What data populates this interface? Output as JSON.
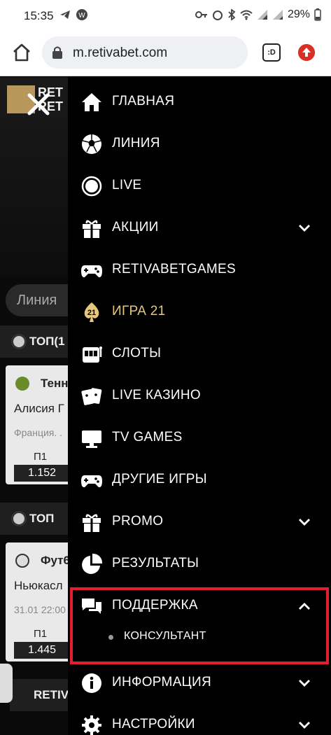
{
  "status_bar": {
    "time": "15:35",
    "battery": "29%"
  },
  "browser": {
    "url": "m.retivabet.com",
    "tabs_label": ":D"
  },
  "background_site": {
    "logo_text_1": "RET",
    "logo_text_2": "RET",
    "search_placeholder": "Линия",
    "section_top_1": "ТОП(1",
    "card_1": {
      "sport": "Тенн",
      "teams": "Алисия Г",
      "league": "Франция. .",
      "odd_label": "П1",
      "odd_value": "1.152"
    },
    "section_top_2": "ТОП",
    "card_2": {
      "sport": "Фут6",
      "teams": "Ньюкасл",
      "league": "31.01 22:00",
      "odd_label": "П1",
      "odd_value": "1.445"
    },
    "section_retiv": "RETIV"
  },
  "menu": {
    "items": [
      {
        "label": "ГЛАВНАЯ",
        "icon": "home-icon"
      },
      {
        "label": "ЛИНИЯ",
        "icon": "soccer-ball-icon"
      },
      {
        "label": "LIVE",
        "icon": "live-circle-icon"
      },
      {
        "label": "АКЦИИ",
        "icon": "gift-icon",
        "expandable": true
      },
      {
        "label": "RETIVABETGAMES",
        "icon": "gamepad-icon"
      },
      {
        "label": "ИГРА 21",
        "icon": "blackjack-21-icon",
        "accent": "#e8c67a"
      },
      {
        "label": "СЛОТЫ",
        "icon": "slot-machine-icon"
      },
      {
        "label": "LIVE КАЗИНО",
        "icon": "cards-icon"
      },
      {
        "label": "TV GAMES",
        "icon": "tv-icon"
      },
      {
        "label": "ДРУГИЕ ИГРЫ",
        "icon": "gamepad-icon"
      },
      {
        "label": "PROMO",
        "icon": "gift-icon",
        "expandable": true
      },
      {
        "label": "РЕЗУЛЬТАТЫ",
        "icon": "pie-chart-icon"
      },
      {
        "label": "ПОДДЕРЖКА",
        "icon": "chat-bubbles-icon",
        "expanded": true
      },
      {
        "label": "ИНФОРМАЦИЯ",
        "icon": "info-icon",
        "expandable": true
      },
      {
        "label": "НАСТРОЙКИ",
        "icon": "gear-icon",
        "expandable": true
      }
    ],
    "support_sub_items": [
      {
        "label": "КОНСУЛЬТАНТ"
      }
    ]
  },
  "colors": {
    "menu_bg": "#000000",
    "accent_gold": "#e8c67a",
    "highlight_red": "#e0202f"
  }
}
